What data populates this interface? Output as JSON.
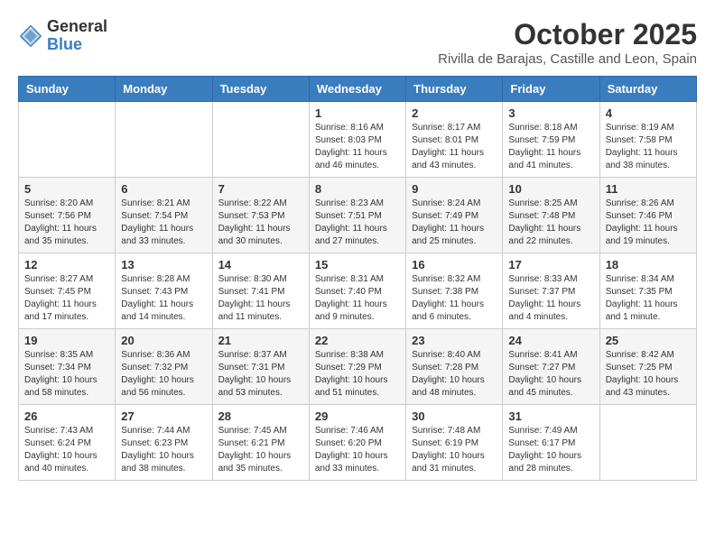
{
  "logo": {
    "general": "General",
    "blue": "Blue"
  },
  "title": "October 2025",
  "subtitle": "Rivilla de Barajas, Castille and Leon, Spain",
  "days_of_week": [
    "Sunday",
    "Monday",
    "Tuesday",
    "Wednesday",
    "Thursday",
    "Friday",
    "Saturday"
  ],
  "weeks": [
    [
      {
        "day": "",
        "info": ""
      },
      {
        "day": "",
        "info": ""
      },
      {
        "day": "",
        "info": ""
      },
      {
        "day": "1",
        "info": "Sunrise: 8:16 AM\nSunset: 8:03 PM\nDaylight: 11 hours and 46 minutes."
      },
      {
        "day": "2",
        "info": "Sunrise: 8:17 AM\nSunset: 8:01 PM\nDaylight: 11 hours and 43 minutes."
      },
      {
        "day": "3",
        "info": "Sunrise: 8:18 AM\nSunset: 7:59 PM\nDaylight: 11 hours and 41 minutes."
      },
      {
        "day": "4",
        "info": "Sunrise: 8:19 AM\nSunset: 7:58 PM\nDaylight: 11 hours and 38 minutes."
      }
    ],
    [
      {
        "day": "5",
        "info": "Sunrise: 8:20 AM\nSunset: 7:56 PM\nDaylight: 11 hours and 35 minutes."
      },
      {
        "day": "6",
        "info": "Sunrise: 8:21 AM\nSunset: 7:54 PM\nDaylight: 11 hours and 33 minutes."
      },
      {
        "day": "7",
        "info": "Sunrise: 8:22 AM\nSunset: 7:53 PM\nDaylight: 11 hours and 30 minutes."
      },
      {
        "day": "8",
        "info": "Sunrise: 8:23 AM\nSunset: 7:51 PM\nDaylight: 11 hours and 27 minutes."
      },
      {
        "day": "9",
        "info": "Sunrise: 8:24 AM\nSunset: 7:49 PM\nDaylight: 11 hours and 25 minutes."
      },
      {
        "day": "10",
        "info": "Sunrise: 8:25 AM\nSunset: 7:48 PM\nDaylight: 11 hours and 22 minutes."
      },
      {
        "day": "11",
        "info": "Sunrise: 8:26 AM\nSunset: 7:46 PM\nDaylight: 11 hours and 19 minutes."
      }
    ],
    [
      {
        "day": "12",
        "info": "Sunrise: 8:27 AM\nSunset: 7:45 PM\nDaylight: 11 hours and 17 minutes."
      },
      {
        "day": "13",
        "info": "Sunrise: 8:28 AM\nSunset: 7:43 PM\nDaylight: 11 hours and 14 minutes."
      },
      {
        "day": "14",
        "info": "Sunrise: 8:30 AM\nSunset: 7:41 PM\nDaylight: 11 hours and 11 minutes."
      },
      {
        "day": "15",
        "info": "Sunrise: 8:31 AM\nSunset: 7:40 PM\nDaylight: 11 hours and 9 minutes."
      },
      {
        "day": "16",
        "info": "Sunrise: 8:32 AM\nSunset: 7:38 PM\nDaylight: 11 hours and 6 minutes."
      },
      {
        "day": "17",
        "info": "Sunrise: 8:33 AM\nSunset: 7:37 PM\nDaylight: 11 hours and 4 minutes."
      },
      {
        "day": "18",
        "info": "Sunrise: 8:34 AM\nSunset: 7:35 PM\nDaylight: 11 hours and 1 minute."
      }
    ],
    [
      {
        "day": "19",
        "info": "Sunrise: 8:35 AM\nSunset: 7:34 PM\nDaylight: 10 hours and 58 minutes."
      },
      {
        "day": "20",
        "info": "Sunrise: 8:36 AM\nSunset: 7:32 PM\nDaylight: 10 hours and 56 minutes."
      },
      {
        "day": "21",
        "info": "Sunrise: 8:37 AM\nSunset: 7:31 PM\nDaylight: 10 hours and 53 minutes."
      },
      {
        "day": "22",
        "info": "Sunrise: 8:38 AM\nSunset: 7:29 PM\nDaylight: 10 hours and 51 minutes."
      },
      {
        "day": "23",
        "info": "Sunrise: 8:40 AM\nSunset: 7:28 PM\nDaylight: 10 hours and 48 minutes."
      },
      {
        "day": "24",
        "info": "Sunrise: 8:41 AM\nSunset: 7:27 PM\nDaylight: 10 hours and 45 minutes."
      },
      {
        "day": "25",
        "info": "Sunrise: 8:42 AM\nSunset: 7:25 PM\nDaylight: 10 hours and 43 minutes."
      }
    ],
    [
      {
        "day": "26",
        "info": "Sunrise: 7:43 AM\nSunset: 6:24 PM\nDaylight: 10 hours and 40 minutes."
      },
      {
        "day": "27",
        "info": "Sunrise: 7:44 AM\nSunset: 6:23 PM\nDaylight: 10 hours and 38 minutes."
      },
      {
        "day": "28",
        "info": "Sunrise: 7:45 AM\nSunset: 6:21 PM\nDaylight: 10 hours and 35 minutes."
      },
      {
        "day": "29",
        "info": "Sunrise: 7:46 AM\nSunset: 6:20 PM\nDaylight: 10 hours and 33 minutes."
      },
      {
        "day": "30",
        "info": "Sunrise: 7:48 AM\nSunset: 6:19 PM\nDaylight: 10 hours and 31 minutes."
      },
      {
        "day": "31",
        "info": "Sunrise: 7:49 AM\nSunset: 6:17 PM\nDaylight: 10 hours and 28 minutes."
      },
      {
        "day": "",
        "info": ""
      }
    ]
  ]
}
